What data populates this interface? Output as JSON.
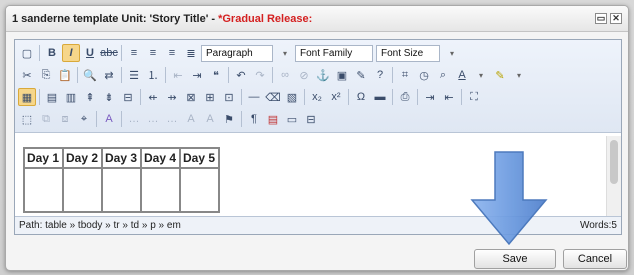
{
  "dialog": {
    "title": "1 sanderne template Unit: 'Story Title' -",
    "title_highlight": "*Gradual Release:"
  },
  "toolbar": {
    "block_format": "Paragraph",
    "font_family": "Font Family",
    "font_size": "Font Size"
  },
  "table": {
    "headers": [
      "Day 1",
      "Day 2",
      "Day 3",
      "Day 4",
      "Day 5"
    ]
  },
  "status": {
    "path": "Path: table » tbody » tr » td » p » em",
    "words": "Words:5"
  },
  "buttons": {
    "save": "Save",
    "cancel": "Cancel"
  },
  "colors": {
    "title_highlight": "#d42020",
    "arrow": "#6c9be0",
    "active_button": "#f6d68a"
  }
}
